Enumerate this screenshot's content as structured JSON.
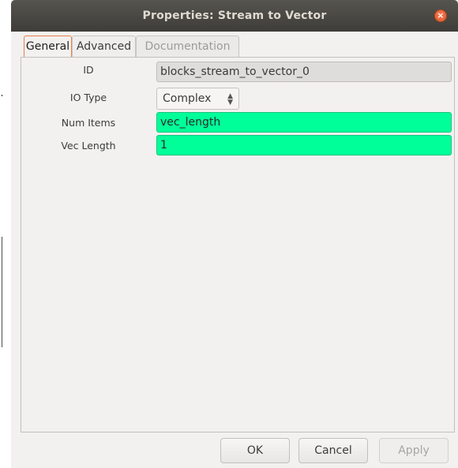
{
  "window": {
    "title": "Properties: Stream to Vector",
    "close_glyph": "×"
  },
  "tabs": [
    {
      "label": "General",
      "state": "active"
    },
    {
      "label": "Advanced",
      "state": "normal"
    },
    {
      "label": "Documentation",
      "state": "disabled"
    }
  ],
  "fields": {
    "id": {
      "label": "ID",
      "value": "blocks_stream_to_vector_0"
    },
    "io_type": {
      "label": "IO Type",
      "value": "Complex"
    },
    "num_items": {
      "label": "Num Items",
      "value": "vec_length"
    },
    "vec_length": {
      "label": "Vec Length",
      "value": "1"
    }
  },
  "buttons": {
    "ok": "OK",
    "cancel": "Cancel",
    "apply": "Apply"
  },
  "colors": {
    "titlebar": "#3e3d39",
    "active_tab_border": "#e97f4d",
    "valid_field": "#00ff99",
    "readonly_field": "#dedddb",
    "close_button": "#e05a2c"
  },
  "icons": {
    "close": "close-icon",
    "combo_arrows": "updown-arrows-icon"
  }
}
